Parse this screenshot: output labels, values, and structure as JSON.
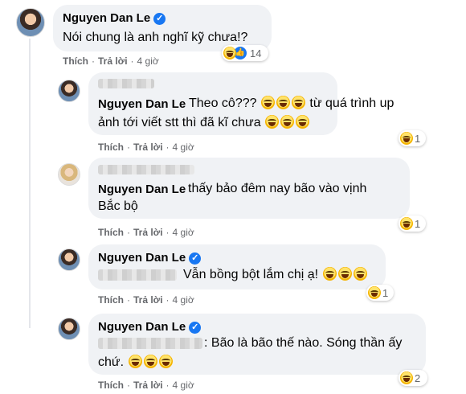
{
  "comments": [
    {
      "name": "Nguyen Dan Le",
      "verified": true,
      "text": "Nói chung là anh nghĩ kỹ chưa!?",
      "like": "Thích",
      "reply": "Trả lời",
      "time": "4 giờ",
      "reaction_count": "14"
    },
    {
      "name": "Nguyen Dan Le",
      "text_a": "Theo cô???",
      "text_b": " từ quá trình up",
      "text_c": "ảnh tới viết stt thì đã kĩ chưa",
      "like": "Thích",
      "reply": "Trả lời",
      "time": "4 giờ",
      "reaction_count": "1"
    },
    {
      "name": "Nguyen Dan Le",
      "text_a": "thấy bảo đêm nay bão vào vịnh",
      "text_b": "Bắc bộ",
      "like": "Thích",
      "reply": "Trả lời",
      "time": "4 giờ",
      "reaction_count": "1"
    },
    {
      "name": "Nguyen Dan Le",
      "verified": true,
      "text": "Vẫn bồng bột lắm chị ạ!",
      "like": "Thích",
      "reply": "Trả lời",
      "time": "4 giờ",
      "reaction_count": "1"
    },
    {
      "name": "Nguyen Dan Le",
      "verified": true,
      "text_a": ": Bão là bão thế nào. Sóng thần ấy",
      "text_b": "chứ.",
      "like": "Thích",
      "reply": "Trả lời",
      "time": "4 giờ",
      "reaction_count": "2"
    }
  ],
  "meta_separator": "·",
  "verified_glyph": "✓",
  "like_glyph": "👍",
  "colors": {
    "bubble": "#f0f2f5",
    "meta": "#65676b",
    "verified": "#1877f2"
  }
}
